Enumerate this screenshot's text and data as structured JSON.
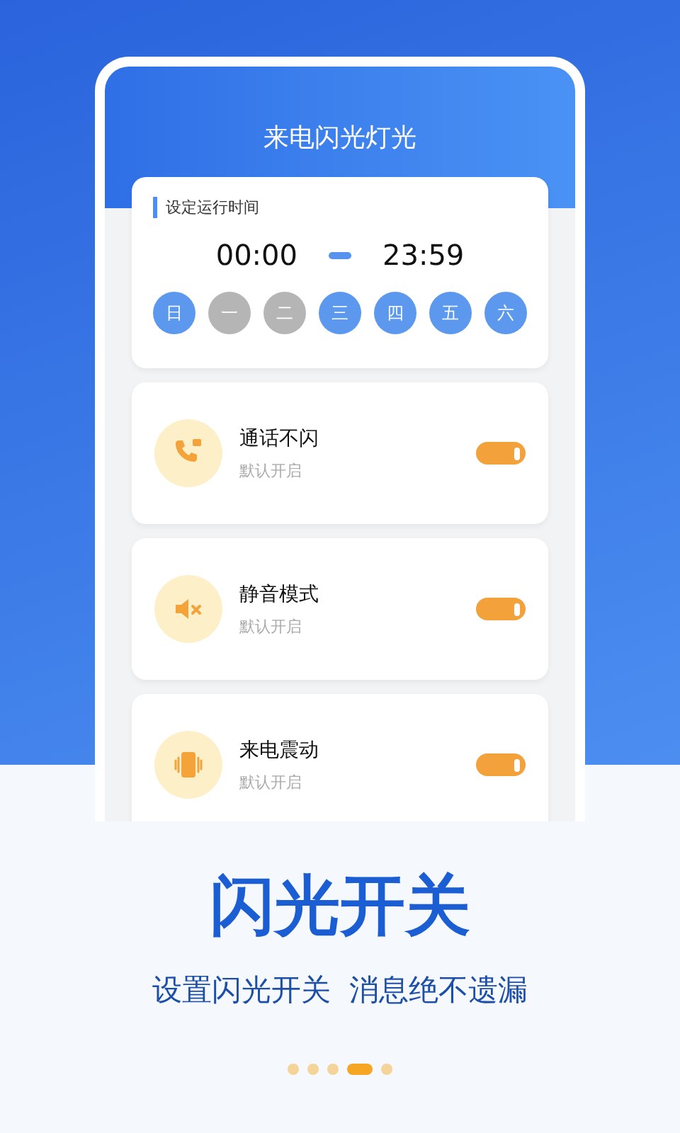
{
  "app_screen": {
    "title": "来电闪光灯光",
    "schedule": {
      "label": "设定运行时间",
      "start_time": "00:00",
      "end_time": "23:59",
      "days": [
        {
          "label": "日",
          "selected": true
        },
        {
          "label": "一",
          "selected": false
        },
        {
          "label": "二",
          "selected": false
        },
        {
          "label": "三",
          "selected": true
        },
        {
          "label": "四",
          "selected": true
        },
        {
          "label": "五",
          "selected": true
        },
        {
          "label": "六",
          "selected": true
        }
      ]
    },
    "settings": [
      {
        "kind": "call",
        "title": "通话不闪",
        "subtitle": "默认开启",
        "on": true
      },
      {
        "kind": "mute",
        "title": "静音模式",
        "subtitle": "默认开启",
        "on": true
      },
      {
        "kind": "vibrate",
        "title": "来电震动",
        "subtitle": "默认开启",
        "on": true
      }
    ]
  },
  "headline": "闪光开关",
  "tagline": "设置闪光开关  消息绝不遗漏",
  "page_dots": [
    {
      "selected": false
    },
    {
      "selected": false
    },
    {
      "selected": false
    },
    {
      "selected": true
    },
    {
      "selected": false
    }
  ]
}
